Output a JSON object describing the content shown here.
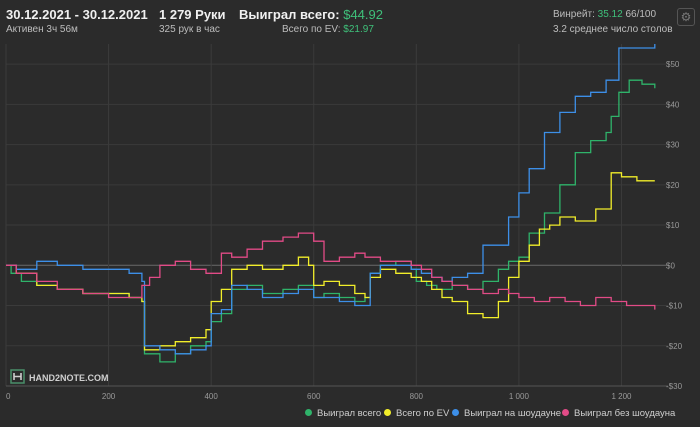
{
  "header": {
    "date_range": "30.12.2021 - 30.12.2021",
    "active": "Активен 3ч 56м",
    "hands": "1 279 Руки",
    "hands_per_hour": "325 рук в час",
    "won_total_label": "Выиграл всего:",
    "won_total_value": "$44.92",
    "ev_total_label": "Всего по EV:",
    "ev_total_value": "$21.97",
    "winrate_label": "Винрейт:",
    "winrate_value": "35.12",
    "winrate_count": "66/100",
    "tables_avg": "3.2 среднее число столов",
    "settings_icon": "gear-icon"
  },
  "watermark": {
    "text": "HAND2NOTE.COM",
    "icon": "h2n-logo-icon"
  },
  "colors": {
    "green": "#2fb36a",
    "yellow": "#f2ee2a",
    "blue": "#3d8fe8",
    "pink": "#e24b87",
    "background": "#2b2b2b",
    "grid": "#3b3b3b"
  },
  "chart_data": {
    "type": "line",
    "title": "",
    "xlabel": "",
    "ylabel": "",
    "xlim": [
      0,
      1279
    ],
    "ylim": [
      -30,
      55
    ],
    "y_axis_position": "right",
    "x_ticks": [
      0,
      200,
      400,
      600,
      800,
      1000,
      1200
    ],
    "x_tick_labels": [
      "0",
      "200",
      "400",
      "600",
      "800",
      "1 000",
      "1 200"
    ],
    "y_ticks": [
      50,
      40,
      30,
      20,
      10,
      0,
      -10,
      -20,
      -30
    ],
    "y_tick_labels": [
      "$50",
      "$40",
      "$30",
      "$20",
      "$10",
      "$0",
      "-$10",
      "-$20",
      "-$30"
    ],
    "grid": true,
    "legend_position": "bottom-right",
    "series": [
      {
        "name": "Выиграл всего",
        "color": "#2fb36a",
        "points": [
          [
            0,
            0
          ],
          [
            10,
            -2
          ],
          [
            30,
            -4
          ],
          [
            60,
            -5
          ],
          [
            100,
            -6
          ],
          [
            150,
            -7
          ],
          [
            200,
            -7
          ],
          [
            240,
            -8
          ],
          [
            265,
            -9
          ],
          [
            270,
            -22
          ],
          [
            300,
            -24
          ],
          [
            330,
            -22
          ],
          [
            360,
            -20
          ],
          [
            390,
            -19
          ],
          [
            400,
            -14
          ],
          [
            420,
            -12
          ],
          [
            440,
            -6
          ],
          [
            470,
            -5
          ],
          [
            500,
            -7
          ],
          [
            540,
            -6
          ],
          [
            570,
            -5
          ],
          [
            600,
            -8
          ],
          [
            620,
            -7
          ],
          [
            650,
            -8
          ],
          [
            680,
            -9
          ],
          [
            700,
            -8
          ],
          [
            710,
            -2
          ],
          [
            730,
            0
          ],
          [
            760,
            1
          ],
          [
            790,
            -1
          ],
          [
            800,
            -4
          ],
          [
            820,
            -5
          ],
          [
            840,
            -6
          ],
          [
            870,
            -5
          ],
          [
            900,
            -6
          ],
          [
            930,
            -4
          ],
          [
            960,
            -1
          ],
          [
            980,
            1
          ],
          [
            1000,
            2
          ],
          [
            1020,
            8
          ],
          [
            1050,
            13
          ],
          [
            1080,
            20
          ],
          [
            1110,
            28
          ],
          [
            1140,
            31
          ],
          [
            1170,
            33
          ],
          [
            1180,
            37
          ],
          [
            1195,
            43
          ],
          [
            1215,
            46
          ],
          [
            1240,
            45
          ],
          [
            1265,
            44
          ]
        ]
      },
      {
        "name": "Всего по EV",
        "color": "#f2ee2a",
        "points": [
          [
            0,
            0
          ],
          [
            20,
            -2
          ],
          [
            60,
            -5
          ],
          [
            100,
            -6
          ],
          [
            150,
            -7
          ],
          [
            200,
            -7
          ],
          [
            240,
            -8
          ],
          [
            265,
            -9
          ],
          [
            270,
            -21
          ],
          [
            300,
            -20
          ],
          [
            330,
            -19
          ],
          [
            360,
            -18
          ],
          [
            390,
            -16
          ],
          [
            400,
            -9
          ],
          [
            420,
            -6
          ],
          [
            440,
            -1
          ],
          [
            470,
            0
          ],
          [
            500,
            -1
          ],
          [
            540,
            0
          ],
          [
            570,
            2
          ],
          [
            590,
            0
          ],
          [
            600,
            -5
          ],
          [
            620,
            -4
          ],
          [
            650,
            -5
          ],
          [
            680,
            -7
          ],
          [
            700,
            -8
          ],
          [
            710,
            -3
          ],
          [
            730,
            -1
          ],
          [
            760,
            -2
          ],
          [
            790,
            -3
          ],
          [
            810,
            -4
          ],
          [
            830,
            -6
          ],
          [
            850,
            -8
          ],
          [
            870,
            -9
          ],
          [
            900,
            -12
          ],
          [
            930,
            -13
          ],
          [
            960,
            -9
          ],
          [
            980,
            -3
          ],
          [
            1000,
            1
          ],
          [
            1020,
            5
          ],
          [
            1040,
            9
          ],
          [
            1060,
            10
          ],
          [
            1080,
            12
          ],
          [
            1110,
            11
          ],
          [
            1150,
            14
          ],
          [
            1180,
            23
          ],
          [
            1200,
            22
          ],
          [
            1230,
            21
          ],
          [
            1265,
            21
          ]
        ]
      },
      {
        "name": "Выиграл на шоудауне",
        "color": "#3d8fe8",
        "points": [
          [
            0,
            0
          ],
          [
            20,
            -1
          ],
          [
            60,
            1
          ],
          [
            100,
            0
          ],
          [
            150,
            -1
          ],
          [
            200,
            -1
          ],
          [
            240,
            -2
          ],
          [
            265,
            -4
          ],
          [
            270,
            -20
          ],
          [
            300,
            -21
          ],
          [
            330,
            -22
          ],
          [
            360,
            -21
          ],
          [
            390,
            -20
          ],
          [
            400,
            -12
          ],
          [
            420,
            -11
          ],
          [
            440,
            -5
          ],
          [
            470,
            -6
          ],
          [
            500,
            -8
          ],
          [
            540,
            -7
          ],
          [
            570,
            -6
          ],
          [
            600,
            -8
          ],
          [
            620,
            -8
          ],
          [
            650,
            -9
          ],
          [
            680,
            -10
          ],
          [
            700,
            -10
          ],
          [
            710,
            -2
          ],
          [
            730,
            0
          ],
          [
            760,
            0
          ],
          [
            790,
            -1
          ],
          [
            810,
            -2
          ],
          [
            830,
            -3
          ],
          [
            850,
            -4
          ],
          [
            870,
            -3
          ],
          [
            900,
            -2
          ],
          [
            930,
            5
          ],
          [
            960,
            5
          ],
          [
            980,
            12
          ],
          [
            1000,
            18
          ],
          [
            1020,
            24
          ],
          [
            1050,
            33
          ],
          [
            1080,
            38
          ],
          [
            1110,
            42
          ],
          [
            1140,
            43
          ],
          [
            1170,
            46
          ],
          [
            1195,
            54
          ],
          [
            1230,
            54
          ],
          [
            1265,
            55
          ]
        ]
      },
      {
        "name": "Выиграл без шоудауна",
        "color": "#e24b87",
        "points": [
          [
            0,
            0
          ],
          [
            20,
            -2
          ],
          [
            60,
            -4
          ],
          [
            100,
            -6
          ],
          [
            150,
            -7
          ],
          [
            200,
            -8
          ],
          [
            240,
            -8
          ],
          [
            265,
            -5
          ],
          [
            280,
            -3
          ],
          [
            300,
            0
          ],
          [
            330,
            1
          ],
          [
            360,
            -1
          ],
          [
            390,
            -2
          ],
          [
            420,
            3
          ],
          [
            440,
            2
          ],
          [
            470,
            4
          ],
          [
            500,
            6
          ],
          [
            540,
            7
          ],
          [
            570,
            8
          ],
          [
            600,
            6
          ],
          [
            620,
            1
          ],
          [
            650,
            2
          ],
          [
            680,
            3
          ],
          [
            700,
            2
          ],
          [
            730,
            1
          ],
          [
            760,
            1
          ],
          [
            790,
            0
          ],
          [
            810,
            -1
          ],
          [
            830,
            -3
          ],
          [
            850,
            -4
          ],
          [
            870,
            -5
          ],
          [
            900,
            -6
          ],
          [
            930,
            -7
          ],
          [
            960,
            -6
          ],
          [
            980,
            -7
          ],
          [
            1000,
            -8
          ],
          [
            1030,
            -9
          ],
          [
            1060,
            -8
          ],
          [
            1090,
            -9
          ],
          [
            1120,
            -10
          ],
          [
            1150,
            -8
          ],
          [
            1180,
            -9
          ],
          [
            1210,
            -10
          ],
          [
            1240,
            -10
          ],
          [
            1265,
            -11
          ]
        ]
      }
    ]
  }
}
